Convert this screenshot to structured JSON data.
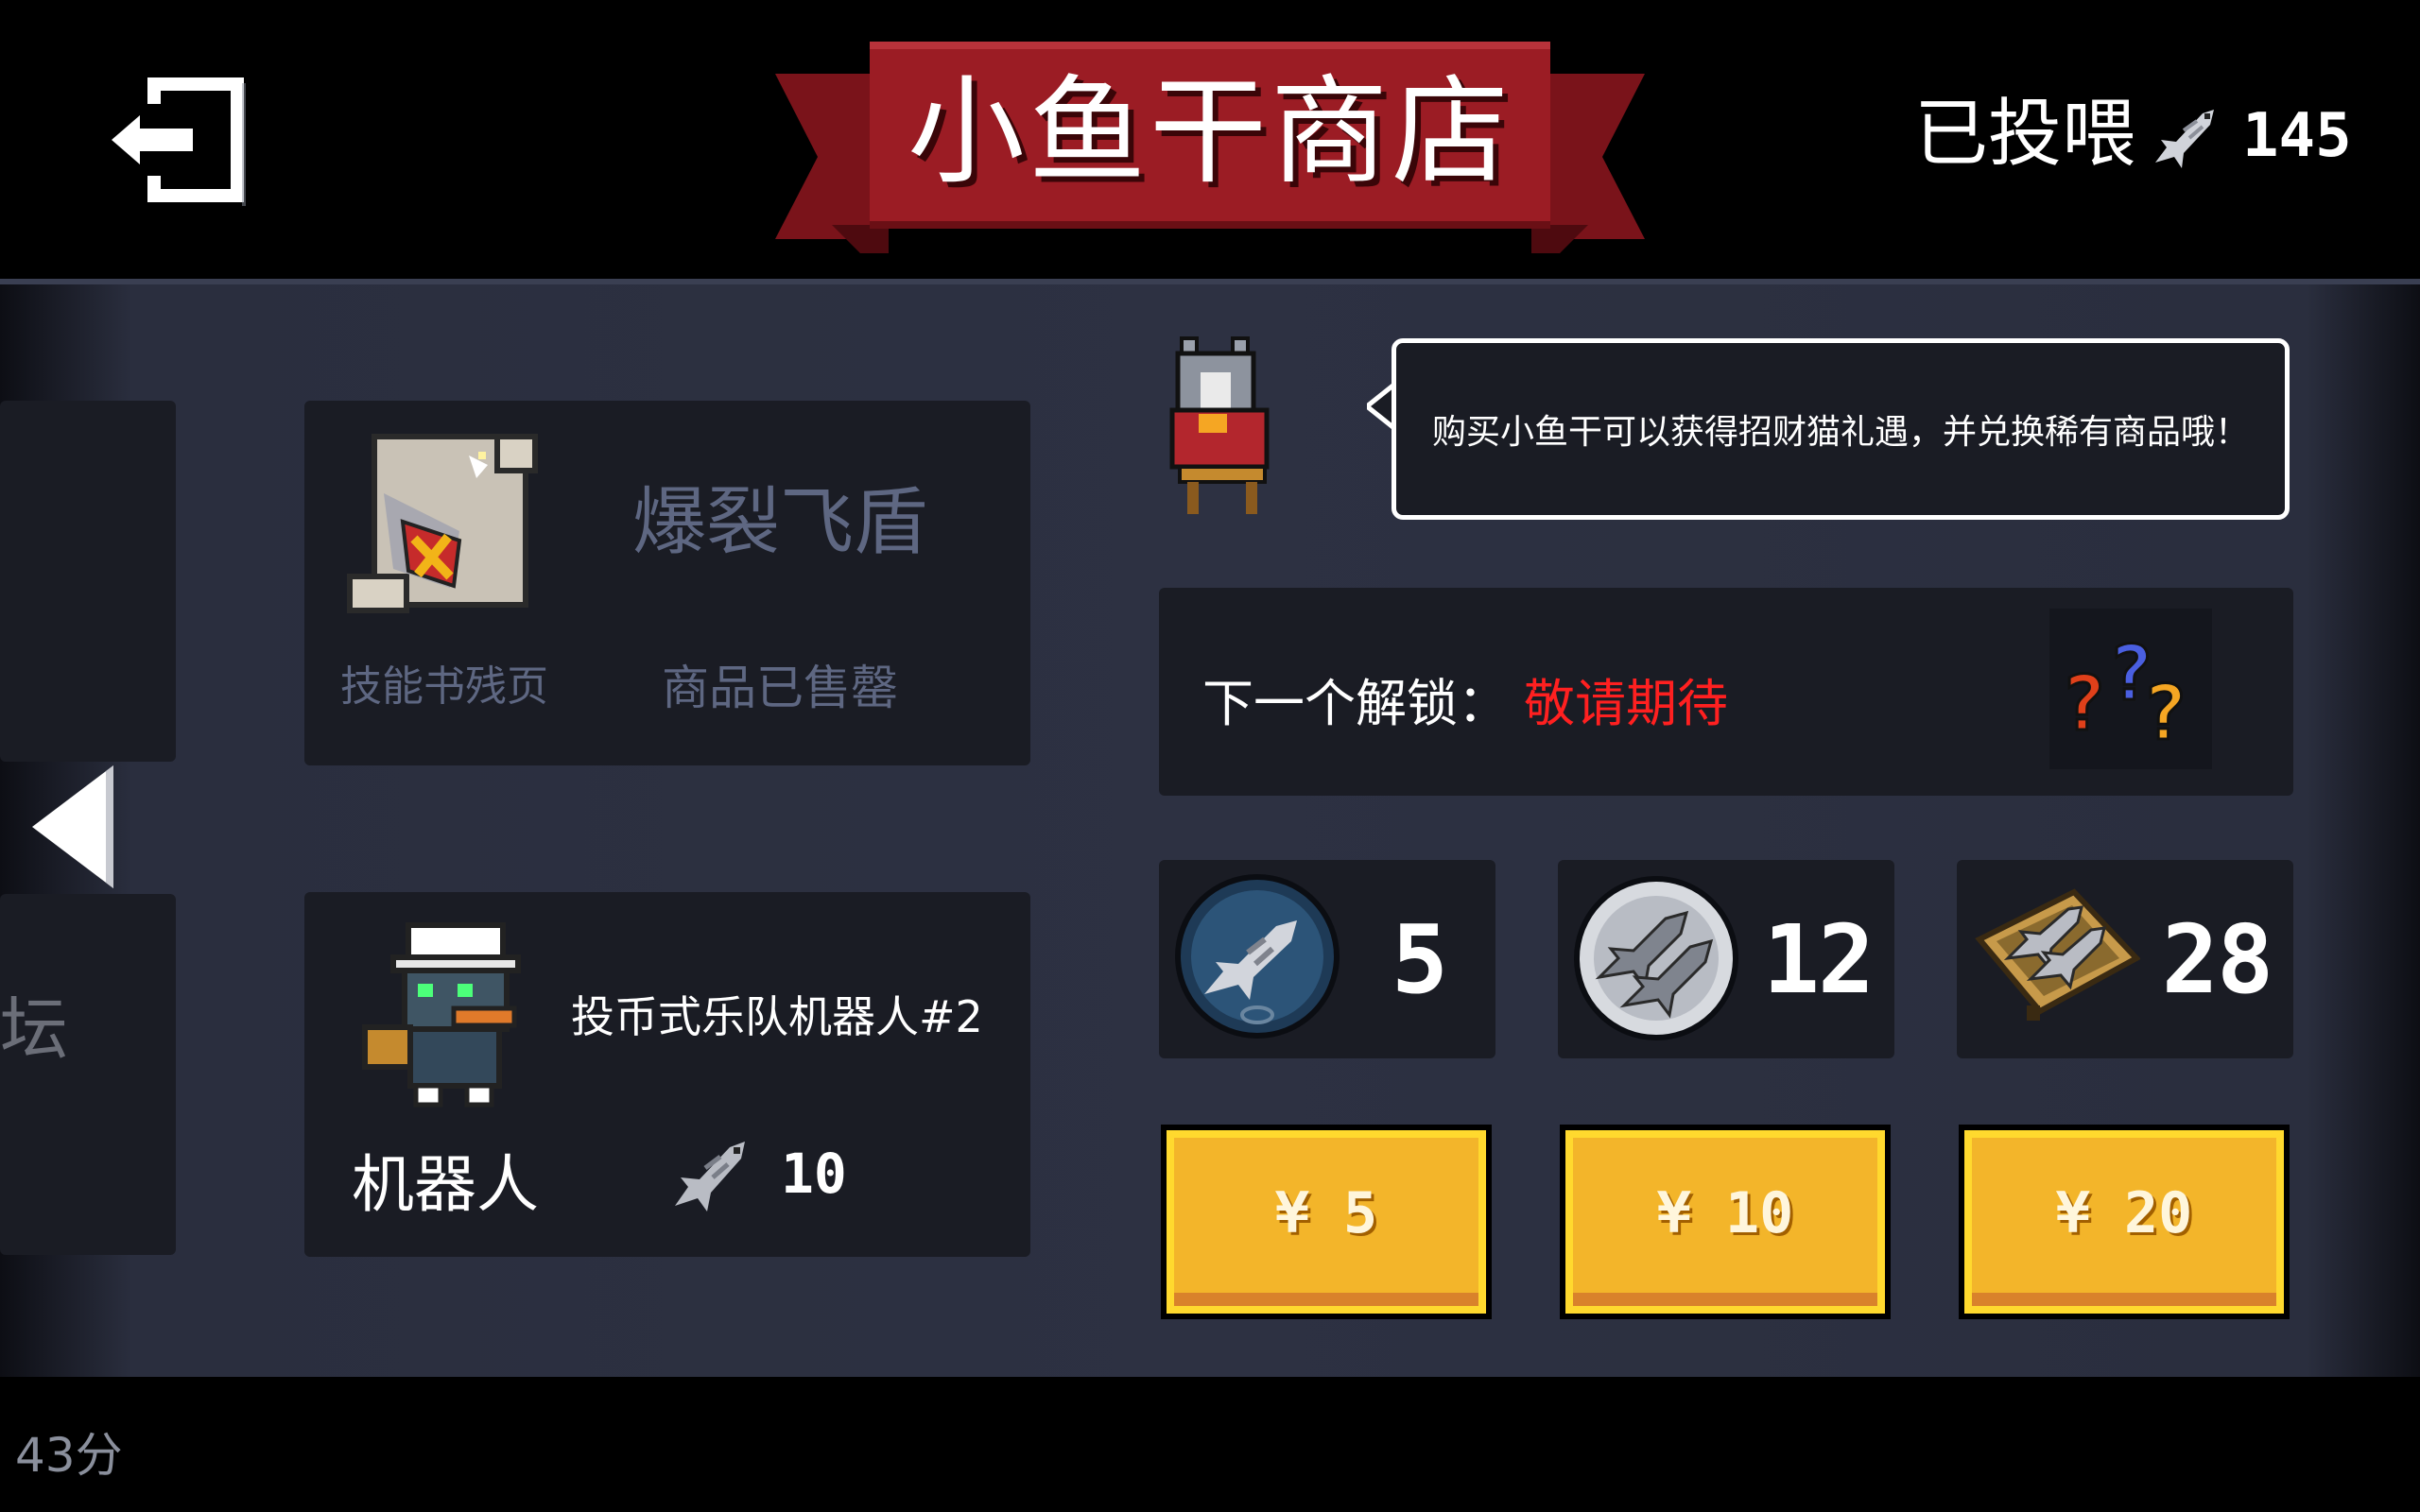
{
  "banner": {
    "title": "小鱼干商店"
  },
  "fed": {
    "label": "已投喂",
    "count": "145"
  },
  "left_partial": {
    "text": "坛"
  },
  "skill_item": {
    "name": "爆裂飞盾",
    "type": "技能书残页",
    "status": "商品已售罄"
  },
  "robot_item": {
    "name": "投币式乐队机器人#2",
    "category": "机器人",
    "price": "10"
  },
  "speech": {
    "text": "购买小鱼干可以获得招财猫礼遇，并兑换稀有商品哦！"
  },
  "unlock": {
    "label": "下一个解锁：",
    "value": "敬请期待"
  },
  "packs": [
    {
      "amount": "5",
      "price": "¥ 5"
    },
    {
      "amount": "12",
      "price": "¥ 10"
    },
    {
      "amount": "28",
      "price": "¥ 20"
    }
  ],
  "fps": {
    "text": "43分"
  },
  "colors": {
    "banner_red": "#9b1c24",
    "button_yellow": "#f3b52a",
    "unlock_red": "#ff2020",
    "panel": "#2d3142",
    "card": "#1a1c24"
  },
  "icons": [
    "exit-icon",
    "fish-icon",
    "scroll-icon",
    "robot-icon",
    "lucky-cat-icon",
    "question-marks-icon",
    "fish-bowl-icon",
    "fish-plate-icon",
    "fish-crate-icon",
    "left-arrow-icon"
  ]
}
